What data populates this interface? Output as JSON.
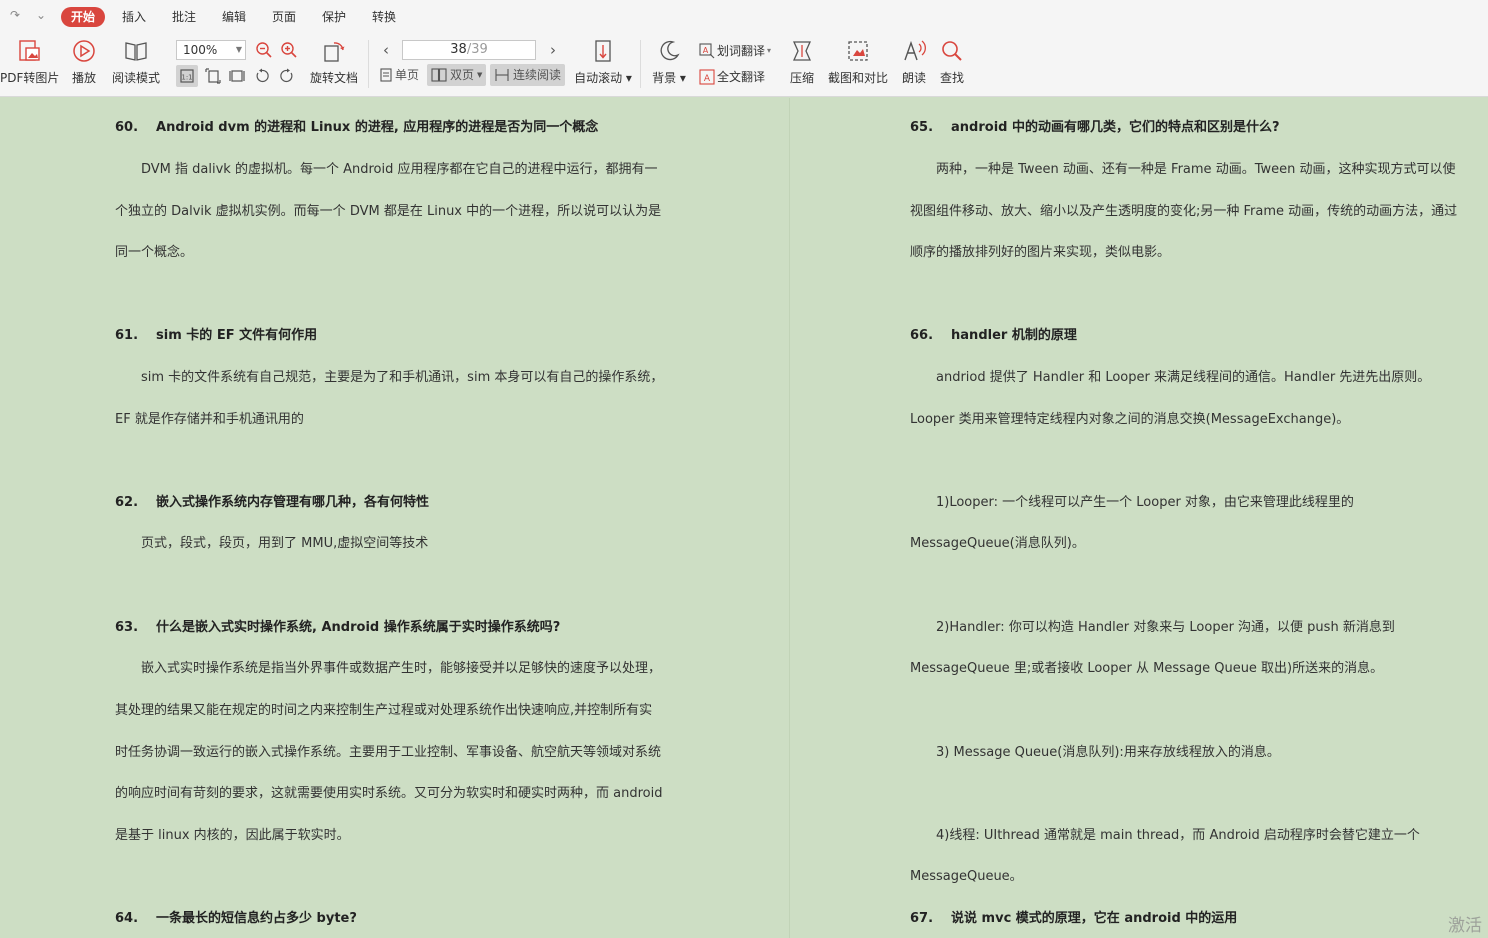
{
  "menubar": {
    "tabs": [
      "开始",
      "插入",
      "批注",
      "编辑",
      "页面",
      "保护",
      "转换"
    ]
  },
  "toolbar": {
    "pdf_to_image": "PDF转图片",
    "play": "播放",
    "read_mode": "阅读模式",
    "zoom_value": "100%",
    "rotate_doc": "旋转文档",
    "page_current": "38",
    "page_total": "/39",
    "single_page": "单页",
    "double_page": "双页",
    "continuous_read": "连续阅读",
    "auto_scroll": "自动滚动",
    "background": "背景",
    "word_translate": "划词翻译",
    "full_translate": "全文翻译",
    "compress": "压缩",
    "screenshot_compare": "截图和对比",
    "read_aloud": "朗读",
    "find": "查找",
    "accent_color": "#d9463e"
  },
  "left_page": [
    {
      "type": "q",
      "num": "60.",
      "text": "Android dvm 的进程和 Linux 的进程, 应用程序的进程是否为同一个概念"
    },
    {
      "type": "p",
      "text": "DVM 指 dalivk 的虚拟机。每一个 Android 应用程序都在它自己的进程中运行，都拥有一"
    },
    {
      "type": "p",
      "text": "个独立的 Dalvik 虚拟机实例。而每一个 DVM 都是在 Linux 中的一个进程，所以说可以认为是"
    },
    {
      "type": "p",
      "text": "同一个概念。"
    },
    {
      "type": "q",
      "num": "61.",
      "text": "sim 卡的 EF 文件有何作用"
    },
    {
      "type": "p",
      "text": "sim 卡的文件系统有自己规范，主要是为了和手机通讯，sim 本身可以有自己的操作系统，"
    },
    {
      "type": "p",
      "text": "EF 就是作存储并和手机通讯用的"
    },
    {
      "type": "q",
      "num": "62.",
      "text": "嵌入式操作系统内存管理有哪几种，各有何特性"
    },
    {
      "type": "p",
      "text": "页式，段式，段页，用到了 MMU,虚拟空间等技术"
    },
    {
      "type": "q",
      "num": "63.",
      "text": "什么是嵌入式实时操作系统, Android 操作系统属于实时操作系统吗?"
    },
    {
      "type": "p",
      "text": "嵌入式实时操作系统是指当外界事件或数据产生时，能够接受并以足够快的速度予以处理，"
    },
    {
      "type": "p",
      "text": "其处理的结果又能在规定的时间之内来控制生产过程或对处理系统作出快速响应,并控制所有实"
    },
    {
      "type": "p",
      "text": "时任务协调一致运行的嵌入式操作系统。主要用于工业控制、军事设备、航空航天等领域对系统"
    },
    {
      "type": "p",
      "text": "的响应时间有苛刻的要求，这就需要使用实时系统。又可分为软实时和硬实时两种，而 android"
    },
    {
      "type": "p",
      "text": "是基于 linux 内核的，因此属于软实时。"
    },
    {
      "type": "q",
      "num": "64.",
      "text": "一条最长的短信息约占多少 byte?"
    }
  ],
  "right_page": [
    {
      "type": "q",
      "num": "65.",
      "text": "android 中的动画有哪几类，它们的特点和区别是什么?"
    },
    {
      "type": "p",
      "text": "两种，一种是 Tween 动画、还有一种是 Frame 动画。Tween 动画，这种实现方式可以使"
    },
    {
      "type": "p",
      "text": "视图组件移动、放大、缩小以及产生透明度的变化;另一种 Frame 动画，传统的动画方法，通过"
    },
    {
      "type": "p",
      "text": "顺序的播放排列好的图片来实现，类似电影。"
    },
    {
      "type": "q",
      "num": "66.",
      "text": "handler 机制的原理"
    },
    {
      "type": "p",
      "text": "andriod 提供了 Handler 和 Looper 来满足线程间的通信。Handler 先进先出原则。"
    },
    {
      "type": "p",
      "text": "Looper 类用来管理特定线程内对象之间的消息交换(MessageExchange)。"
    },
    {
      "type": "p",
      "text": "1)Looper: 一个线程可以产生一个 Looper 对象，由它来管理此线程里的"
    },
    {
      "type": "p",
      "text": "MessageQueue(消息队列)。"
    },
    {
      "type": "p",
      "text": "2)Handler: 你可以构造 Handler 对象来与 Looper 沟通，以便 push 新消息到"
    },
    {
      "type": "p",
      "text": "MessageQueue 里;或者接收 Looper 从 Message Queue 取出)所送来的消息。"
    },
    {
      "type": "p",
      "text": "3) Message Queue(消息队列):用来存放线程放入的消息。"
    },
    {
      "type": "p",
      "text": "4)线程: UIthread 通常就是 main thread，而 Android 启动程序时会替它建立一个"
    },
    {
      "type": "p",
      "text": "MessageQueue。"
    },
    {
      "type": "q",
      "num": "67.",
      "text": "说说 mvc 模式的原理，它在 android 中的运用"
    }
  ],
  "watermark": "激活"
}
